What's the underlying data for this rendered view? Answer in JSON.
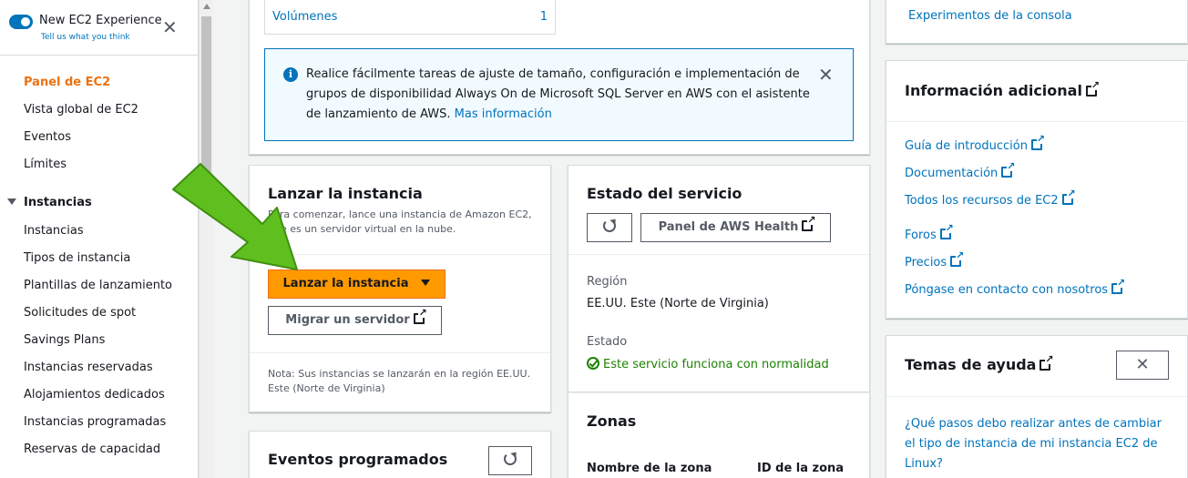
{
  "sidebar": {
    "toggle_title": "New EC2 Experience",
    "toggle_link": "Tell us what you think",
    "items": [
      {
        "label": "Panel de EC2",
        "active": true
      },
      {
        "label": "Vista global de EC2"
      },
      {
        "label": "Eventos"
      },
      {
        "label": "Límites"
      }
    ],
    "section_instances": "Instancias",
    "instance_items": [
      "Instancias",
      "Tipos de instancia",
      "Plantillas de lanzamiento",
      "Solicitudes de spot",
      "Savings Plans",
      "Instancias reservadas",
      "Alojamientos dedicados",
      "Instancias programadas",
      "Reservas de capacidad"
    ]
  },
  "resources": {
    "volumes_label": "Volúmenes",
    "volumes_count": "1"
  },
  "info_banner": {
    "text": "Realice fácilmente tareas de ajuste de tamaño, configuración e implementación de grupos de disponibilidad Always On de Microsoft SQL Server en AWS con el asistente de lanzamiento de AWS.",
    "link": "Mas información"
  },
  "launch": {
    "title": "Lanzar la instancia",
    "description": "Para comenzar, lance una instancia de Amazon EC2, que es un servidor virtual en la nube.",
    "launch_button": "Lanzar la instancia",
    "migrate_button": "Migrar un servidor",
    "note": "Nota: Sus instancias se lanzarán en la región EE.UU. Este (Norte de Virginia)"
  },
  "scheduled_events": {
    "title": "Eventos programados"
  },
  "service_health": {
    "title": "Estado del servicio",
    "health_button": "Panel de AWS Health",
    "region_label": "Región",
    "region_value": "EE.UU. Este (Norte de Virginia)",
    "status_label": "Estado",
    "status_value": "Este servicio funciona con normalidad",
    "status_color": "#1d8102"
  },
  "zones": {
    "title": "Zonas",
    "col_name": "Nombre de la zona",
    "col_id": "ID de la zona"
  },
  "right": {
    "console_experiments": "Experimentos de la consola",
    "additional_info_title": "Información adicional",
    "links": [
      "Guía de introducción",
      "Documentación",
      "Todos los recursos de EC2",
      "Foros",
      "Precios",
      "Póngase en contacto con nosotros"
    ],
    "help_title": "Temas de ayuda",
    "help_question": "¿Qué pasos debo realizar antes de cambiar el tipo de instancia de mi instancia EC2 de Linux?"
  },
  "colors": {
    "accent": "#0073bb",
    "primary_button": "#ff9900",
    "active_nav": "#ec7211",
    "annotation_arrow": "#5fbf1f"
  }
}
